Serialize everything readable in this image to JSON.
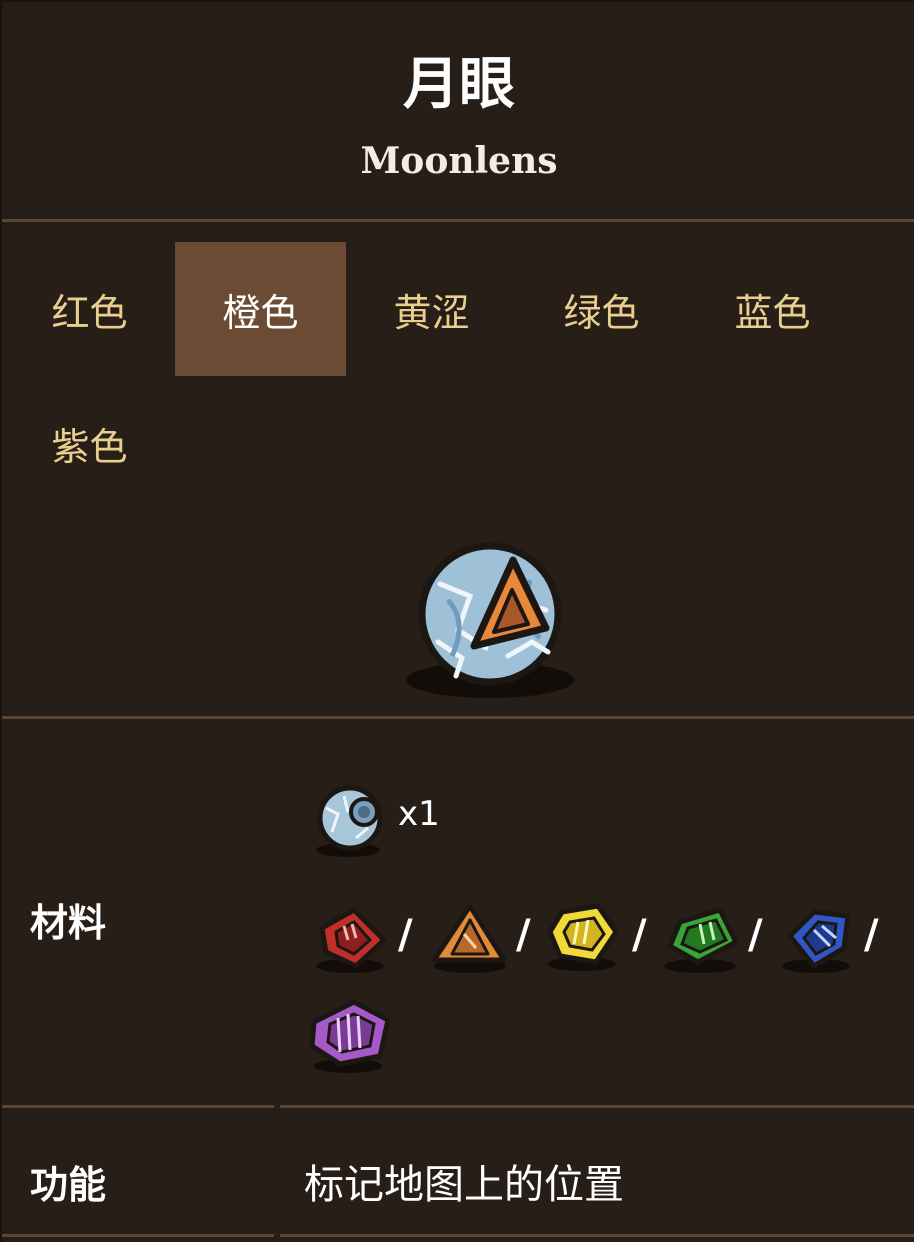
{
  "header": {
    "title": "月眼",
    "subtitle": "Moonlens"
  },
  "tabs": [
    {
      "label": "红色",
      "active": false
    },
    {
      "label": "橙色",
      "active": true
    },
    {
      "label": "黄涩",
      "active": false
    },
    {
      "label": "绿色",
      "active": false
    },
    {
      "label": "蓝色",
      "active": false
    },
    {
      "label": "紫色",
      "active": false
    }
  ],
  "hero": {
    "icon": "moon-lens-orange-icon"
  },
  "materials": {
    "label": "材料",
    "base": {
      "icon": "moon-rock-icon",
      "quantity": "x1"
    },
    "separator": "/",
    "gems": [
      {
        "icon": "red-gem-icon",
        "color": "#c0302b"
      },
      {
        "icon": "orange-gem-icon",
        "color": "#e18a37"
      },
      {
        "icon": "yellow-gem-icon",
        "color": "#f1d93a"
      },
      {
        "icon": "green-gem-icon",
        "color": "#3aa537"
      },
      {
        "icon": "blue-gem-icon",
        "color": "#2f57c8"
      },
      {
        "icon": "purple-gem-icon",
        "color": "#a659c9"
      }
    ]
  },
  "function": {
    "label": "功能",
    "value": "标记地图上的位置"
  },
  "colors": {
    "background": "#271e17",
    "divider": "#5b4634",
    "active_tab": "#6b4b33",
    "tab_text": "#e9cf8e"
  }
}
